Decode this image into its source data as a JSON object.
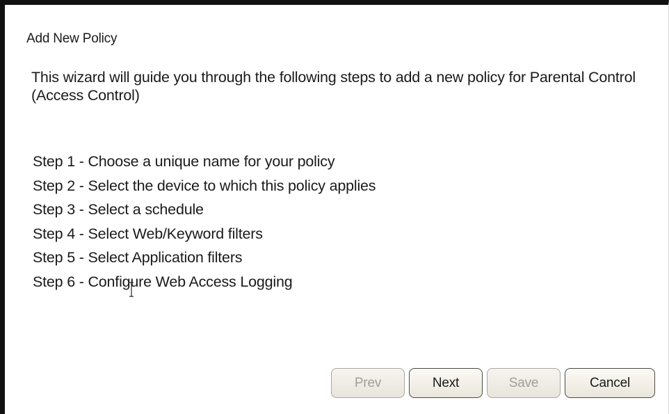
{
  "wizard": {
    "title": "Add New Policy",
    "intro": "This wizard will guide you through the following steps to add a new policy for Parental Control (Access Control)",
    "steps": [
      "Step 1 - Choose a unique name for your policy",
      "Step 2 - Select the device to which this policy applies",
      "Step 3 - Select a schedule",
      "Step 4 - Select Web/Keyword filters",
      "Step 5 - Select Application filters",
      "Step 6 - Configure Web Access Logging"
    ]
  },
  "buttons": {
    "prev": {
      "label": "Prev",
      "enabled": false
    },
    "next": {
      "label": "Next",
      "enabled": true
    },
    "save": {
      "label": "Save",
      "enabled": false
    },
    "cancel": {
      "label": "Cancel",
      "enabled": true
    }
  },
  "cursor": {
    "icon": "text-cursor-icon"
  }
}
